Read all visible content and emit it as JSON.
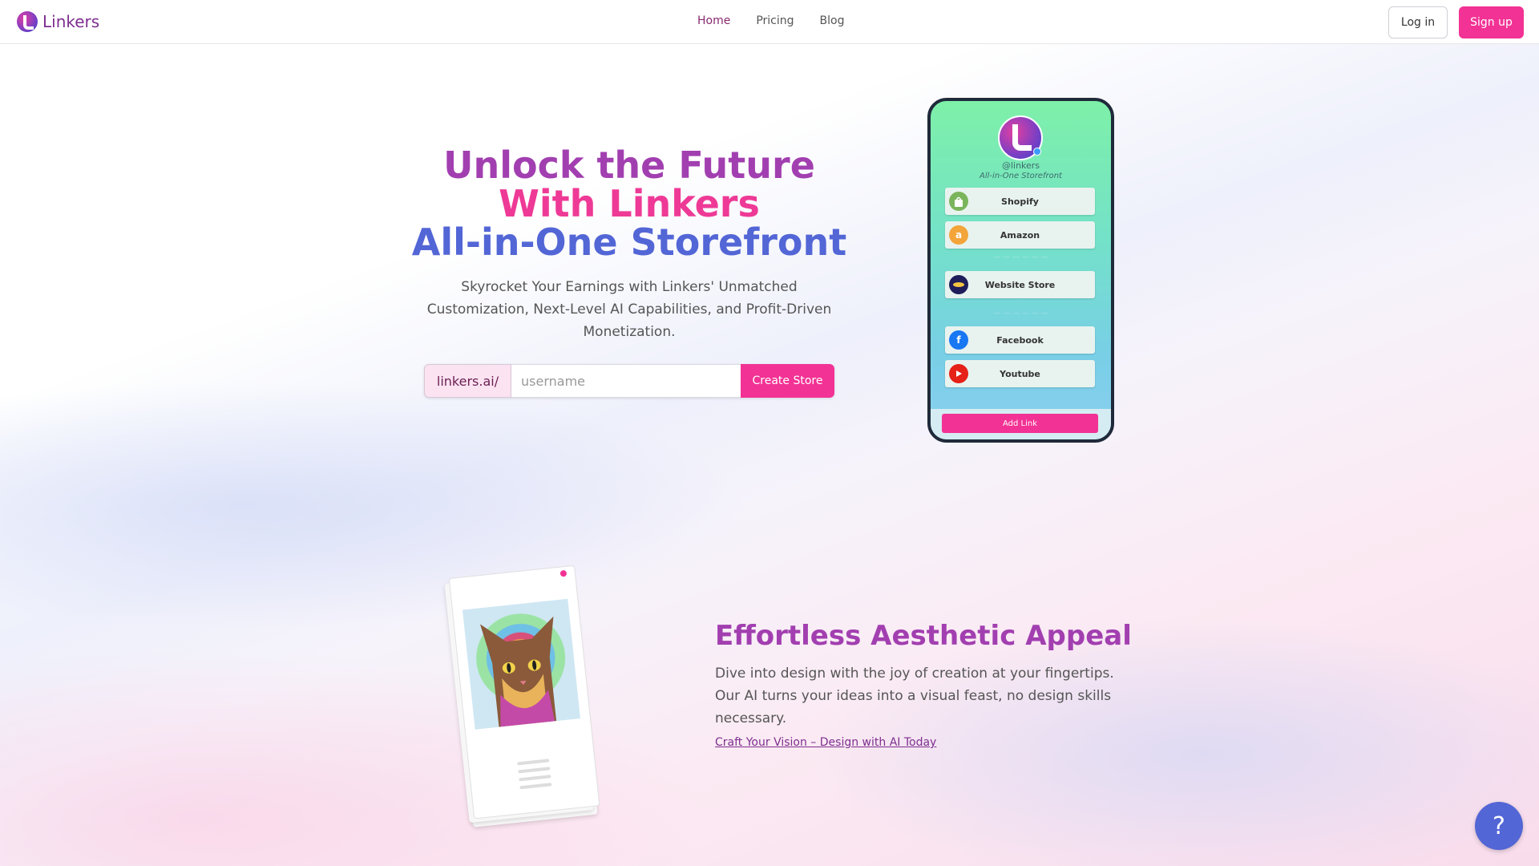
{
  "header": {
    "brand": "Linkers",
    "nav": [
      {
        "label": "Home",
        "active": true
      },
      {
        "label": "Pricing",
        "active": false
      },
      {
        "label": "Blog",
        "active": false
      }
    ],
    "login_label": "Log in",
    "signup_label": "Sign up"
  },
  "hero": {
    "title_line1": "Unlock the Future",
    "title_line2": "With Linkers",
    "title_line3": "All-in-One Storefront",
    "subtitle": "Skyrocket Your Earnings with Linkers' Unmatched Customization, Next-Level AI Capabilities, and Profit-Driven Monetization.",
    "prefix": "linkers.ai/",
    "username_placeholder": "username",
    "username_value": "",
    "create_label": "Create Store"
  },
  "phone": {
    "handle": "@linkers",
    "tagline": "All-in-One Storefront",
    "links": [
      {
        "label": "Shopify",
        "icon": "shopify-icon",
        "color": "#7ab55c"
      },
      {
        "label": "Amazon",
        "icon": "amazon-icon",
        "color": "#f3a53a"
      },
      {
        "label": "Website Store",
        "icon": "website-store-icon",
        "color": "#1f1d5a"
      },
      {
        "label": "Facebook",
        "icon": "facebook-icon",
        "color": "#1877f2"
      },
      {
        "label": "Youtube",
        "icon": "youtube-icon",
        "color": "#e62117"
      }
    ],
    "add_link_label": "Add Link"
  },
  "feature": {
    "title": "Effortless Aesthetic Appeal",
    "text": "Dive into design with the joy of creation at your fingertips. Our AI turns your ideas into a visual feast, no design skills necessary.",
    "link": "Craft Your Vision – Design with AI Today"
  },
  "help": {
    "label": "?"
  },
  "colors": {
    "accent_pink": "#f23294",
    "brand_purple": "#a23fb0",
    "brand_blue": "#5366d6"
  }
}
